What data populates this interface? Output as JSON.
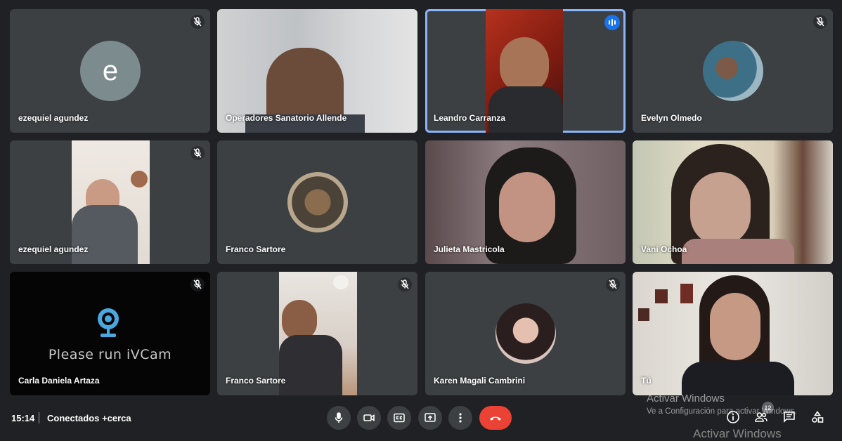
{
  "participants": [
    {
      "name": "ezequiel agundez",
      "avatar_letter": "e",
      "muted": true
    },
    {
      "name": "Operadores Sanatorio Allende",
      "muted": false
    },
    {
      "name": "Leandro Carranza",
      "speaking": true
    },
    {
      "name": "Evelyn Olmedo",
      "muted": true
    },
    {
      "name": "ezequiel agundez",
      "muted": true
    },
    {
      "name": "Franco Sartore",
      "muted": false
    },
    {
      "name": "Julieta Mastricola",
      "muted": false
    },
    {
      "name": "Vani Ochoa",
      "muted": false
    },
    {
      "name": "Carla Daniela Artaza",
      "muted": true,
      "screen_text": "Please run iVCam"
    },
    {
      "name": "Franco Sartore",
      "muted": true
    },
    {
      "name": "Karen Magali Cambrini",
      "muted": true
    },
    {
      "name": "Tú",
      "muted": false
    }
  ],
  "footer": {
    "time": "15:14",
    "separator": "|",
    "meeting_name": "Conectados +cerca",
    "participant_count": "12"
  },
  "controls": [
    "mic-icon",
    "camera-icon",
    "captions-icon",
    "present-icon",
    "more-options-icon",
    "hangup-icon"
  ],
  "right_controls": [
    "info-icon",
    "people-icon",
    "chat-icon",
    "activities-icon"
  ],
  "watermark": {
    "line1": "Activar Windows",
    "line2": "Ve a Configuración para activar Windows.",
    "line3": "Activar Windows"
  },
  "colors": {
    "background": "#202124",
    "tile": "#3c4043",
    "active_border": "#8ab4f8",
    "hangup": "#ea4335",
    "speaking": "#1a73e8"
  }
}
